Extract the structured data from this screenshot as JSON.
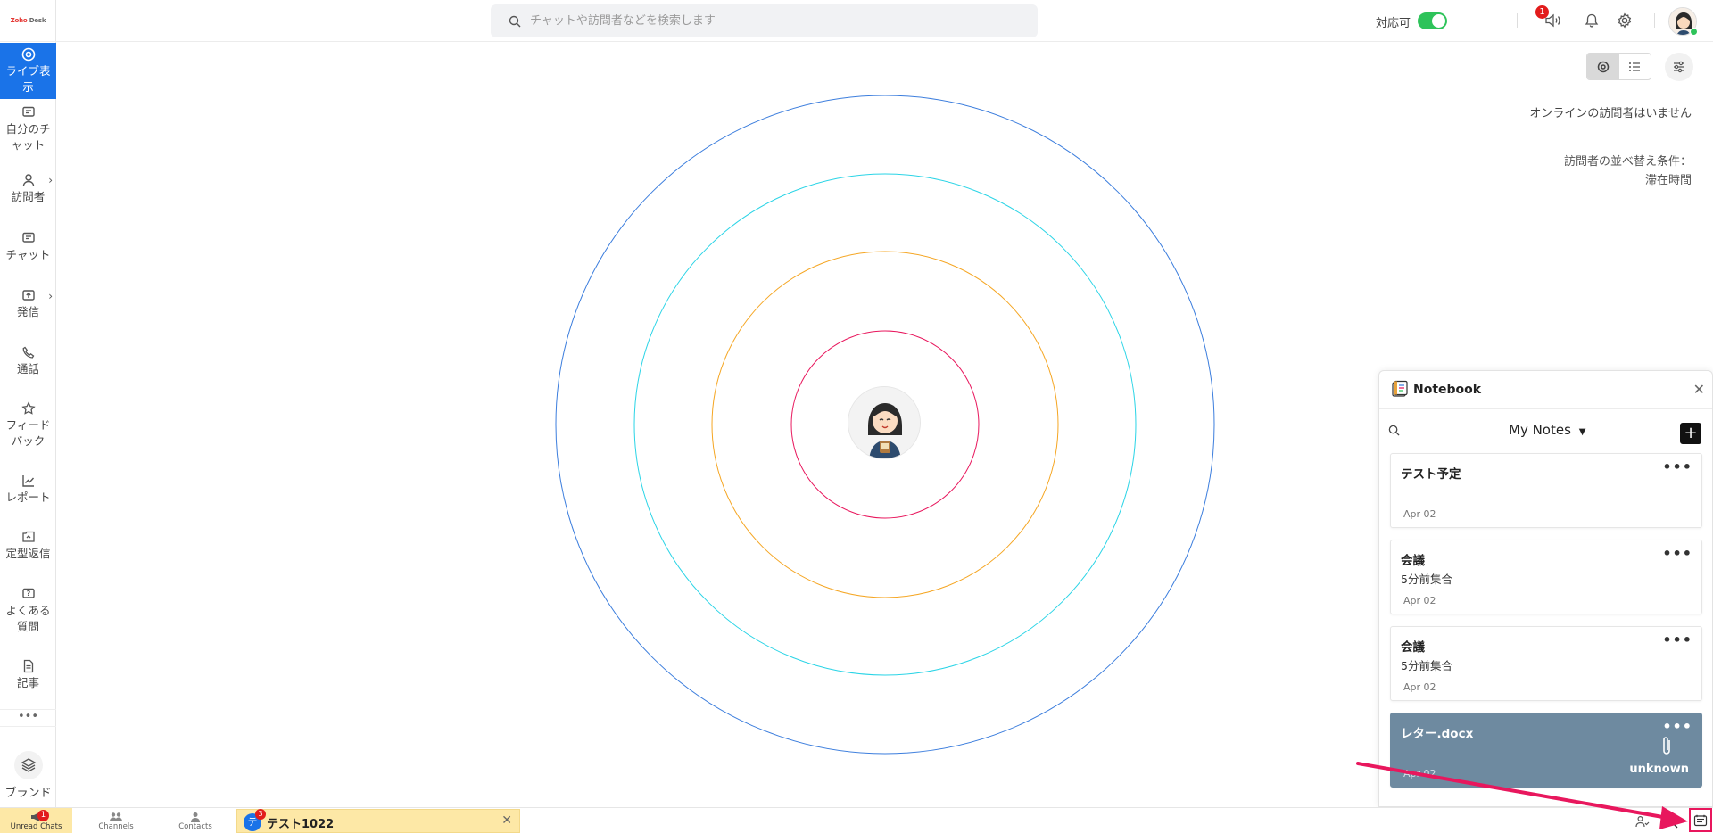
{
  "logo": {
    "text_a": "Zoho",
    "text_b": "Desk"
  },
  "sidebar": {
    "items": [
      {
        "label": "ライブ表示"
      },
      {
        "label": "自分のチャット"
      },
      {
        "label": "訪問者"
      },
      {
        "label": "チャット"
      },
      {
        "label": "発信"
      },
      {
        "label": "通話"
      },
      {
        "label": "フィードバック"
      },
      {
        "label": "レポート"
      },
      {
        "label": "定型返信"
      },
      {
        "label": "よくある質問"
      },
      {
        "label": "記事"
      }
    ],
    "more": "•••",
    "brand_label": "ブランド"
  },
  "header": {
    "search_placeholder": "チャットや訪問者などを検索します",
    "status_label": "対応可",
    "status_on": true,
    "notification_count": "1"
  },
  "live_view": {
    "no_visitors": "オンラインの訪問者はいません",
    "sort_label": "訪問者の並べ替え条件：",
    "sort_value": "滞在時間",
    "ring_colors": [
      "#3b7ddd",
      "#2ad4e6",
      "#f5a623",
      "#e8175d"
    ]
  },
  "notebook": {
    "title": "Notebook",
    "filter": "My Notes",
    "add": "+",
    "notes": [
      {
        "title": "テスト予定",
        "body": "",
        "date": "Apr 02"
      },
      {
        "title": "会議",
        "body": "5分前集合",
        "date": "Apr 02"
      },
      {
        "title": "会議",
        "body": "5分前集合",
        "date": "Apr 02"
      },
      {
        "title": "レター.docx",
        "body": "",
        "date": "Apr 02",
        "file_type": "unknown"
      }
    ]
  },
  "bottombar": {
    "unread_label": "Unread Chats",
    "unread_count": "1",
    "channels_label": "Channels",
    "contacts_label": "Contacts",
    "chat_tab": {
      "initial": "テ",
      "name": "テスト1022",
      "badge": "3"
    }
  }
}
